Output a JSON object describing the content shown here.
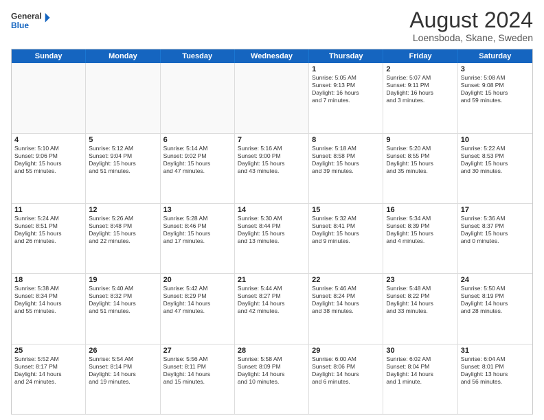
{
  "logo": {
    "line1": "General",
    "line2": "Blue"
  },
  "title": "August 2024",
  "location": "Loensboda, Skane, Sweden",
  "days_of_week": [
    "Sunday",
    "Monday",
    "Tuesday",
    "Wednesday",
    "Thursday",
    "Friday",
    "Saturday"
  ],
  "weeks": [
    [
      {
        "day": "",
        "text": "",
        "empty": true
      },
      {
        "day": "",
        "text": "",
        "empty": true
      },
      {
        "day": "",
        "text": "",
        "empty": true
      },
      {
        "day": "",
        "text": "",
        "empty": true
      },
      {
        "day": "1",
        "text": "Sunrise: 5:05 AM\nSunset: 9:13 PM\nDaylight: 16 hours\nand 7 minutes."
      },
      {
        "day": "2",
        "text": "Sunrise: 5:07 AM\nSunset: 9:11 PM\nDaylight: 16 hours\nand 3 minutes."
      },
      {
        "day": "3",
        "text": "Sunrise: 5:08 AM\nSunset: 9:08 PM\nDaylight: 15 hours\nand 59 minutes."
      }
    ],
    [
      {
        "day": "4",
        "text": "Sunrise: 5:10 AM\nSunset: 9:06 PM\nDaylight: 15 hours\nand 55 minutes."
      },
      {
        "day": "5",
        "text": "Sunrise: 5:12 AM\nSunset: 9:04 PM\nDaylight: 15 hours\nand 51 minutes."
      },
      {
        "day": "6",
        "text": "Sunrise: 5:14 AM\nSunset: 9:02 PM\nDaylight: 15 hours\nand 47 minutes."
      },
      {
        "day": "7",
        "text": "Sunrise: 5:16 AM\nSunset: 9:00 PM\nDaylight: 15 hours\nand 43 minutes."
      },
      {
        "day": "8",
        "text": "Sunrise: 5:18 AM\nSunset: 8:58 PM\nDaylight: 15 hours\nand 39 minutes."
      },
      {
        "day": "9",
        "text": "Sunrise: 5:20 AM\nSunset: 8:55 PM\nDaylight: 15 hours\nand 35 minutes."
      },
      {
        "day": "10",
        "text": "Sunrise: 5:22 AM\nSunset: 8:53 PM\nDaylight: 15 hours\nand 30 minutes."
      }
    ],
    [
      {
        "day": "11",
        "text": "Sunrise: 5:24 AM\nSunset: 8:51 PM\nDaylight: 15 hours\nand 26 minutes."
      },
      {
        "day": "12",
        "text": "Sunrise: 5:26 AM\nSunset: 8:48 PM\nDaylight: 15 hours\nand 22 minutes."
      },
      {
        "day": "13",
        "text": "Sunrise: 5:28 AM\nSunset: 8:46 PM\nDaylight: 15 hours\nand 17 minutes."
      },
      {
        "day": "14",
        "text": "Sunrise: 5:30 AM\nSunset: 8:44 PM\nDaylight: 15 hours\nand 13 minutes."
      },
      {
        "day": "15",
        "text": "Sunrise: 5:32 AM\nSunset: 8:41 PM\nDaylight: 15 hours\nand 9 minutes."
      },
      {
        "day": "16",
        "text": "Sunrise: 5:34 AM\nSunset: 8:39 PM\nDaylight: 15 hours\nand 4 minutes."
      },
      {
        "day": "17",
        "text": "Sunrise: 5:36 AM\nSunset: 8:37 PM\nDaylight: 15 hours\nand 0 minutes."
      }
    ],
    [
      {
        "day": "18",
        "text": "Sunrise: 5:38 AM\nSunset: 8:34 PM\nDaylight: 14 hours\nand 55 minutes."
      },
      {
        "day": "19",
        "text": "Sunrise: 5:40 AM\nSunset: 8:32 PM\nDaylight: 14 hours\nand 51 minutes."
      },
      {
        "day": "20",
        "text": "Sunrise: 5:42 AM\nSunset: 8:29 PM\nDaylight: 14 hours\nand 47 minutes."
      },
      {
        "day": "21",
        "text": "Sunrise: 5:44 AM\nSunset: 8:27 PM\nDaylight: 14 hours\nand 42 minutes."
      },
      {
        "day": "22",
        "text": "Sunrise: 5:46 AM\nSunset: 8:24 PM\nDaylight: 14 hours\nand 38 minutes."
      },
      {
        "day": "23",
        "text": "Sunrise: 5:48 AM\nSunset: 8:22 PM\nDaylight: 14 hours\nand 33 minutes."
      },
      {
        "day": "24",
        "text": "Sunrise: 5:50 AM\nSunset: 8:19 PM\nDaylight: 14 hours\nand 28 minutes."
      }
    ],
    [
      {
        "day": "25",
        "text": "Sunrise: 5:52 AM\nSunset: 8:17 PM\nDaylight: 14 hours\nand 24 minutes."
      },
      {
        "day": "26",
        "text": "Sunrise: 5:54 AM\nSunset: 8:14 PM\nDaylight: 14 hours\nand 19 minutes."
      },
      {
        "day": "27",
        "text": "Sunrise: 5:56 AM\nSunset: 8:11 PM\nDaylight: 14 hours\nand 15 minutes."
      },
      {
        "day": "28",
        "text": "Sunrise: 5:58 AM\nSunset: 8:09 PM\nDaylight: 14 hours\nand 10 minutes."
      },
      {
        "day": "29",
        "text": "Sunrise: 6:00 AM\nSunset: 8:06 PM\nDaylight: 14 hours\nand 6 minutes."
      },
      {
        "day": "30",
        "text": "Sunrise: 6:02 AM\nSunset: 8:04 PM\nDaylight: 14 hours\nand 1 minute."
      },
      {
        "day": "31",
        "text": "Sunrise: 6:04 AM\nSunset: 8:01 PM\nDaylight: 13 hours\nand 56 minutes."
      }
    ]
  ]
}
